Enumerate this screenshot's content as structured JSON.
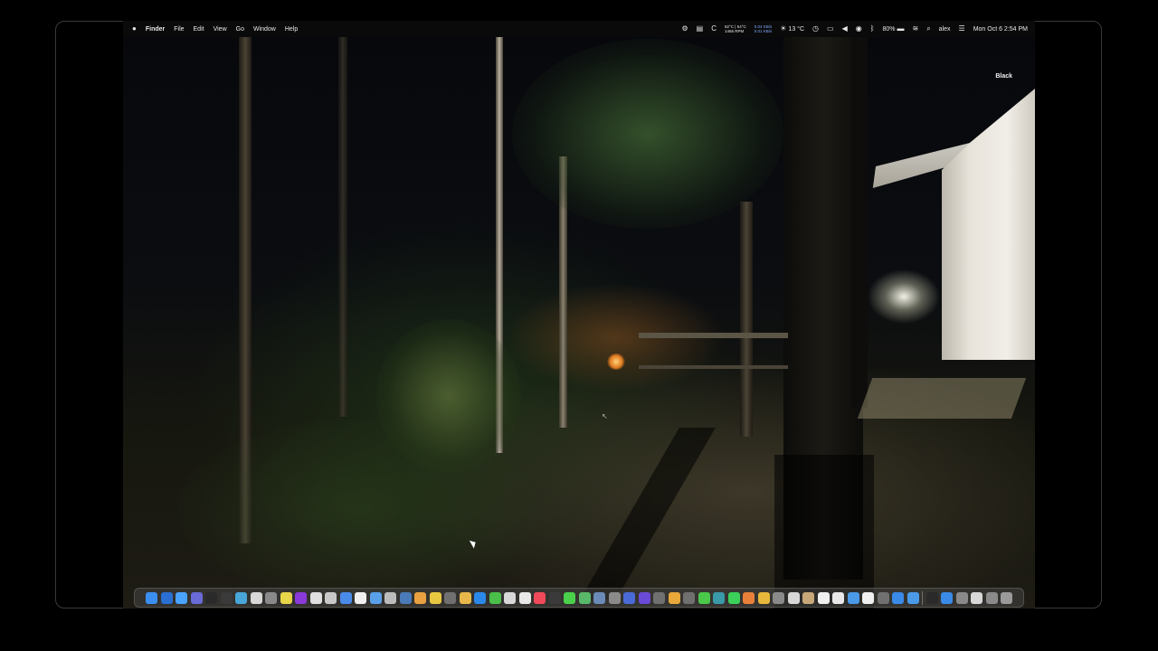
{
  "menubar": {
    "apple_icon": "",
    "app_name": "Finder",
    "menus": [
      "File",
      "Edit",
      "View",
      "Go",
      "Window",
      "Help"
    ],
    "status": {
      "cpu_temp": "82°C | 54°C",
      "fan_rpm": "1466 RPM",
      "net_up": "0.04 KB/s",
      "net_down": "0.01 KB/s",
      "weather": "13 °C",
      "battery": "80%",
      "user": "alex",
      "datetime": "Mon Oct 6  2:54 PM"
    }
  },
  "desktop": {
    "label": "Black"
  },
  "dock": {
    "icons": [
      {
        "name": "finder-icon",
        "color": "#3b8ff0"
      },
      {
        "name": "trash-folder-icon",
        "color": "#2a6fd1"
      },
      {
        "name": "safari-icon",
        "color": "#4aa3ff"
      },
      {
        "name": "calendar-icon",
        "color": "#6a6ad8"
      },
      {
        "name": "terminal-icon",
        "color": "#2a2a2a"
      },
      {
        "name": "control-icon",
        "color": "#3a3a3a"
      },
      {
        "name": "network-icon",
        "color": "#49a6d8"
      },
      {
        "name": "notes-icon",
        "color": "#d8d8d8"
      },
      {
        "name": "settings-icon",
        "color": "#8a8a8a"
      },
      {
        "name": "stickies-icon",
        "color": "#e8d64a"
      },
      {
        "name": "onenote-icon",
        "color": "#8a3ad8"
      },
      {
        "name": "document-icon",
        "color": "#e0e0e0"
      },
      {
        "name": "camera-icon",
        "color": "#c8c8c8"
      },
      {
        "name": "browser-icon",
        "color": "#4a8ae8"
      },
      {
        "name": "textedit-icon",
        "color": "#f0f0f0"
      },
      {
        "name": "compass-icon",
        "color": "#5aa0e8"
      },
      {
        "name": "printer-icon",
        "color": "#bcbcbc"
      },
      {
        "name": "disk-icon",
        "color": "#4a7ab8"
      },
      {
        "name": "stopwatch-icon",
        "color": "#e8a040"
      },
      {
        "name": "chrome-icon",
        "color": "#e8c840"
      },
      {
        "name": "server-icon",
        "color": "#707070"
      },
      {
        "name": "pencil-icon",
        "color": "#e8b84a"
      },
      {
        "name": "xcode-icon",
        "color": "#2a88e8"
      },
      {
        "name": "numbers-icon",
        "color": "#4ac04a"
      },
      {
        "name": "clipboard-icon",
        "color": "#d8d8d8"
      },
      {
        "name": "file-icon",
        "color": "#e8e8e8"
      },
      {
        "name": "music-icon",
        "color": "#f04a5a"
      },
      {
        "name": "grid-icon",
        "color": "#3a3a3a"
      },
      {
        "name": "messages-icon",
        "color": "#4ad04a"
      },
      {
        "name": "maps-icon",
        "color": "#5ab86a"
      },
      {
        "name": "preview-icon",
        "color": "#6a8ab8"
      },
      {
        "name": "utility-icon",
        "color": "#8a8a8a"
      },
      {
        "name": "facebook-icon",
        "color": "#4a6ad8"
      },
      {
        "name": "star-icon",
        "color": "#6a4ad8"
      },
      {
        "name": "archive-icon",
        "color": "#707070"
      },
      {
        "name": "coin-icon",
        "color": "#e8a83a"
      },
      {
        "name": "keychain-icon",
        "color": "#707070"
      },
      {
        "name": "facetime-icon",
        "color": "#4ac84a"
      },
      {
        "name": "vpn-icon",
        "color": "#3a9aa8"
      },
      {
        "name": "whatsapp-icon",
        "color": "#3ad05a"
      },
      {
        "name": "firefox-icon",
        "color": "#e8803a"
      },
      {
        "name": "todo-icon",
        "color": "#e8b83a"
      },
      {
        "name": "screenshot-icon",
        "color": "#8a8a8a"
      },
      {
        "name": "info-icon",
        "color": "#d8d8d8"
      },
      {
        "name": "contacts-icon",
        "color": "#c8a878"
      },
      {
        "name": "textedit2-icon",
        "color": "#f0f0f0"
      },
      {
        "name": "mail-icon",
        "color": "#e8e8e8"
      },
      {
        "name": "chat-icon",
        "color": "#4a9ae8"
      },
      {
        "name": "calendar-6-icon",
        "color": "#f0f0f0"
      },
      {
        "name": "calculator-icon",
        "color": "#707070"
      },
      {
        "name": "appstore-icon",
        "color": "#3a8ae8"
      },
      {
        "name": "wifi-icon",
        "color": "#4a9ae8"
      },
      {
        "name": "console-icon",
        "color": "#2a2a2a"
      },
      {
        "name": "appstore2-icon",
        "color": "#3a8ae8"
      },
      {
        "name": "apple2-icon",
        "color": "#8a8a8a"
      },
      {
        "name": "document2-icon",
        "color": "#d8d8d8"
      },
      {
        "name": "tools-icon",
        "color": "#8a8a8a"
      },
      {
        "name": "trash-icon",
        "color": "#9a9a9a"
      }
    ]
  }
}
